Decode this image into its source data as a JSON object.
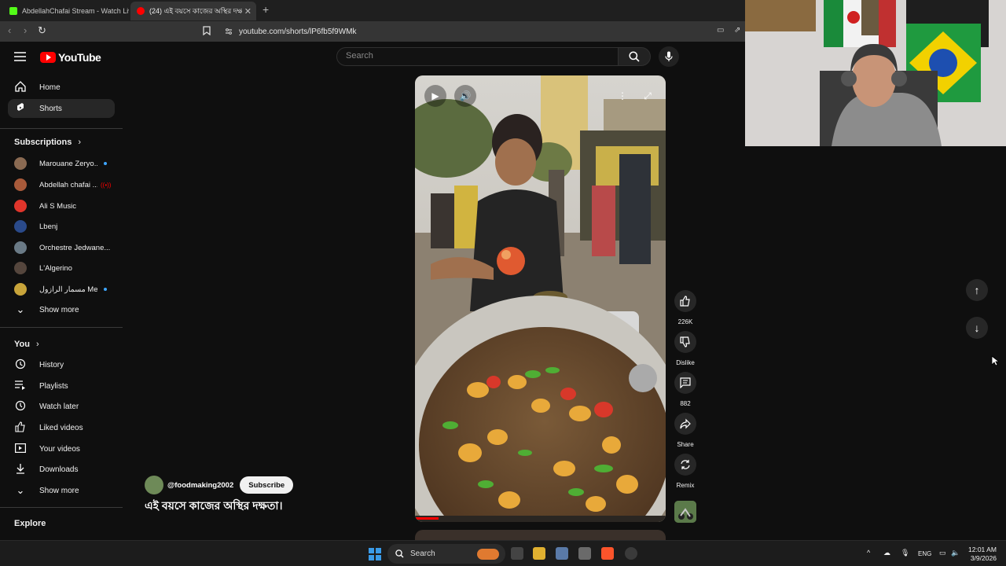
{
  "browser": {
    "tabs": [
      {
        "label": "AbdellahChafai Stream - Watch Live o",
        "favicon_color": "#53fc18"
      },
      {
        "label": "(24) এই বয়সে কাজের অস্থির দক্ষ",
        "favicon_color": "#ff0000"
      }
    ],
    "new_tab_icon": "plus-icon",
    "url": "youtube.com/shorts/lP6fb5f9WMk"
  },
  "youtube": {
    "logo_text": "YouTube",
    "search_placeholder": "Search"
  },
  "sidebar": {
    "main": [
      {
        "label": "Home",
        "icon": "home-icon"
      },
      {
        "label": "Shorts",
        "icon": "shorts-icon",
        "active": true
      }
    ],
    "subscriptions_title": "Subscriptions",
    "subscriptions": [
      {
        "name": "Marouane Zeryo...",
        "avatar_color": "#8a6a52",
        "live_color": "#3ea6ff"
      },
      {
        "name": "Abdellah chafai ...",
        "avatar_color": "#a85a3a",
        "live_color": "#ff0000"
      },
      {
        "name": "Ali S Music",
        "avatar_color": "#e0352b"
      },
      {
        "name": "Lbenj",
        "avatar_color": "#2a4a8a"
      },
      {
        "name": "Orchestre Jedwane...",
        "avatar_color": "#6a7a86"
      },
      {
        "name": "L'Algerino",
        "avatar_color": "#55463d"
      },
      {
        "name": "مسمار الرازول Mes...",
        "avatar_color": "#c8a43a",
        "live_color": "#3ea6ff"
      }
    ],
    "show_more_label": "Show more",
    "you_title": "You",
    "you_items": [
      {
        "label": "History",
        "icon": "history-icon"
      },
      {
        "label": "Playlists",
        "icon": "playlists-icon"
      },
      {
        "label": "Watch later",
        "icon": "watch-later-icon"
      },
      {
        "label": "Liked videos",
        "icon": "like-icon"
      },
      {
        "label": "Your videos",
        "icon": "your-videos-icon"
      },
      {
        "label": "Downloads",
        "icon": "download-icon"
      }
    ],
    "you_show_more_label": "Show more",
    "explore_title": "Explore"
  },
  "short": {
    "channel_handle": "@foodmaking2002",
    "subscribe_label": "Subscribe",
    "title": "এই বয়সে কাজের অস্থির দক্ষতা।",
    "actions": [
      {
        "label": "226K",
        "icon": "thumb-up-icon"
      },
      {
        "label": "Dislike",
        "icon": "thumb-down-icon"
      },
      {
        "label": "882",
        "icon": "comment-icon"
      },
      {
        "label": "Share",
        "icon": "share-icon"
      },
      {
        "label": "Remix",
        "icon": "remix-icon"
      }
    ]
  },
  "taskbar": {
    "search_label": "Search",
    "lang": "ENG",
    "time": "12:01 AM",
    "date": "3/9/2026"
  },
  "colors": {
    "background": "#0f0f0f",
    "youtube_red": "#ff0000",
    "chip": "#272727"
  }
}
